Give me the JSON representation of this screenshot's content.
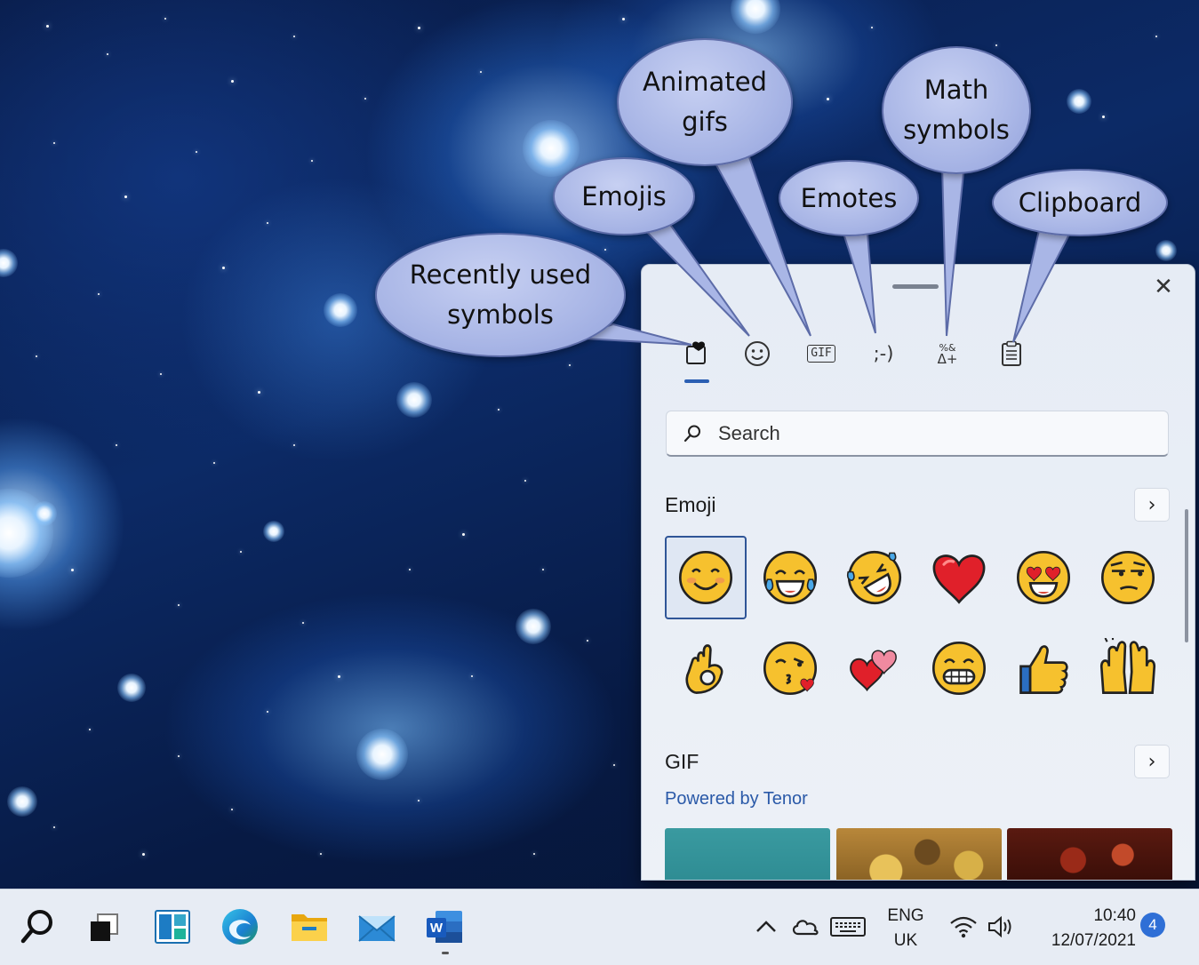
{
  "callouts": {
    "animated_gifs": [
      "Animated",
      "gifs"
    ],
    "math_symbols": [
      "Math",
      "symbols"
    ],
    "emojis": "Emojis",
    "emotes": "Emotes",
    "clipboard": "Clipboard",
    "recently_used": [
      "Recently used",
      "symbols"
    ]
  },
  "panel": {
    "close_glyph": "✕",
    "tabs": [
      {
        "name": "recently-used",
        "icon": "clock-heart-icon"
      },
      {
        "name": "emoji",
        "icon": "smiley-icon"
      },
      {
        "name": "gif",
        "icon": "gif-icon",
        "label": "GIF"
      },
      {
        "name": "kaomoji",
        "icon": "kaomoji-icon",
        "label": ";-)"
      },
      {
        "name": "symbols",
        "icon": "symbols-icon",
        "label_top": "%&",
        "label_bottom": "Δ+"
      },
      {
        "name": "clipboard",
        "icon": "clipboard-icon"
      }
    ],
    "active_tab": "recently-used",
    "search": {
      "placeholder": "Search",
      "value": ""
    },
    "emoji_section": {
      "title": "Emoji",
      "more_glyph": "›",
      "items": [
        "smiling-face-with-smiling-eyes",
        "face-with-tears-of-joy",
        "rolling-on-the-floor-laughing",
        "red-heart",
        "smiling-face-with-heart-eyes",
        "unamused-face",
        "ok-hand",
        "face-blowing-a-kiss",
        "two-hearts",
        "beaming-face-with-smiling-eyes",
        "thumbs-up",
        "raising-hands"
      ],
      "selected_index": 0
    },
    "gif_section": {
      "title": "GIF",
      "more_glyph": "›",
      "powered_by": "Powered by Tenor"
    }
  },
  "taskbar": {
    "lang_top": "ENG",
    "lang_bottom": "UK",
    "time": "10:40",
    "date": "12/07/2021",
    "notification_count": "4",
    "app_icons": [
      "search-icon",
      "task-view-icon",
      "widgets-icon",
      "edge-icon",
      "file-explorer-icon",
      "mail-icon",
      "word-icon"
    ],
    "tray_icons": [
      "chevron-up-icon",
      "onedrive-cloud-icon",
      "touch-keyboard-icon",
      "wifi-icon",
      "speaker-icon"
    ]
  },
  "colors": {
    "callout_fill": "#a9b6e6",
    "accent": "#2b5fb3",
    "link": "#2a59a8",
    "emoji_yellow": "#f6c12e"
  }
}
